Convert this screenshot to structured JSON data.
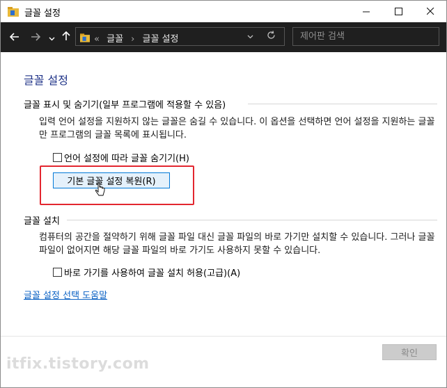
{
  "window": {
    "title": "글꼴 설정",
    "icon": "folder-icon",
    "controls": [
      "minimize-icon",
      "maximize-icon",
      "close-icon"
    ]
  },
  "nav": {
    "back_icon": "arrow-left-icon",
    "forward_icon": "arrow-right-icon",
    "recent_icon": "chevron-down-icon",
    "up_icon": "arrow-up-icon",
    "breadcrumb_prefix": "«",
    "breadcrumb": [
      "글꼴",
      "설정"
    ],
    "crumb_separator": "›",
    "crumb_1": "글꼴",
    "crumb_2": "글꼴 설정",
    "search_placeholder": "제어판 검색"
  },
  "content": {
    "heading": "글꼴 설정",
    "section1_title": "글꼴 표시 및 숨기기(일부 프로그램에 적용할 수 있음)",
    "section1_text": "입력 언어 설정을 지원하지 않는 글꼴은 숨길 수 있습니다. 이 옵션을 선택하면 언어 설정을 지원하는 글꼴만 프로그램의 글꼴 목록에 표시됩니다.",
    "hide_fonts_checkbox": "언어 설정에 따라 글꼴 숨기기(H)",
    "restore_button": "기본 글꼴 설정 복원(R)",
    "section2_title": "글꼴 설치",
    "section2_text": "컴퓨터의 공간을 절약하기 위해 글꼴 파일 대신 글꼴 파일의 바로 가기만 설치할 수 있습니다. 그러나 글꼴 파일이 없어지면 해당 글꼴 파일의 바로 가기도 사용하지 못할 수 있습니다.",
    "shortcut_checkbox": "바로 가기를 사용하여 글꼴 설치 허용(고급)(A)",
    "help_link": "글꼴 설정 선택 도움말"
  },
  "footer": {
    "ok_button": "확인"
  },
  "watermark": "itfix.tistory.com",
  "colors": {
    "heading": "#1e3287",
    "link": "#0b62c4",
    "highlight_box": "#e3262f",
    "navbar": "#1f1f1f"
  }
}
